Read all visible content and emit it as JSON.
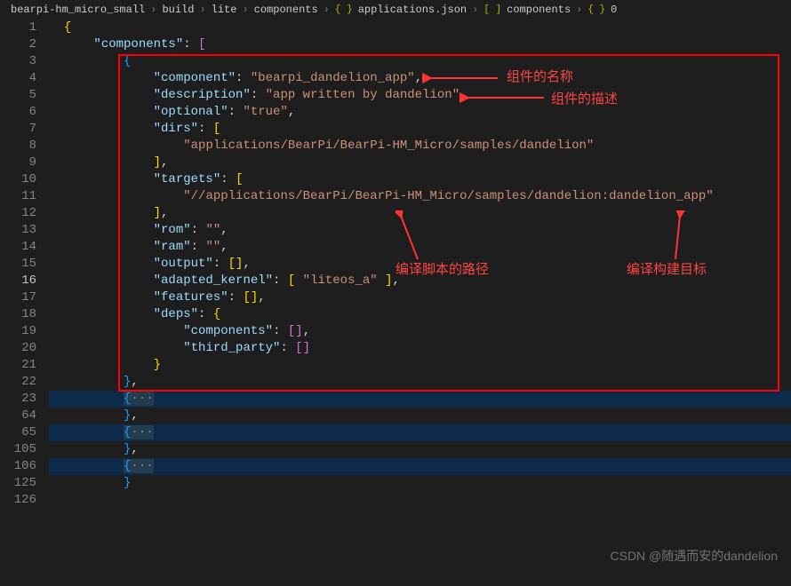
{
  "breadcrumb": {
    "items": [
      {
        "label": "bearpi-hm_micro_small",
        "icon": ""
      },
      {
        "label": "build",
        "icon": ""
      },
      {
        "label": "lite",
        "icon": ""
      },
      {
        "label": "components",
        "icon": ""
      },
      {
        "label": "applications.json",
        "icon": "{ }",
        "iconColor": "#b8b800"
      },
      {
        "label": "components",
        "icon": "[ ]",
        "iconColor": "#b8b800"
      },
      {
        "label": "0",
        "icon": "{ }",
        "iconColor": "#b8b800"
      }
    ]
  },
  "lines": {
    "l1": "1",
    "l2": "2",
    "l3": "3",
    "l4": "4",
    "l5": "5",
    "l6": "6",
    "l7": "7",
    "l8": "8",
    "l9": "9",
    "l10": "10",
    "l11": "11",
    "l12": "12",
    "l13": "13",
    "l14": "14",
    "l15": "15",
    "l16": "16",
    "l17": "17",
    "l18": "18",
    "l19": "19",
    "l20": "20",
    "l21": "21",
    "l22": "22",
    "l23": "23",
    "l64": "64",
    "l65": "65",
    "l105": "105",
    "l106": "106",
    "l125": "125",
    "l126": "126"
  },
  "code": {
    "components_key": "\"components\"",
    "component_key": "\"component\"",
    "component_val": "\"bearpi_dandelion_app\"",
    "description_key": "\"description\"",
    "description_val": "\"app written by dandelion\"",
    "optional_key": "\"optional\"",
    "optional_val": "\"true\"",
    "dirs_key": "\"dirs\"",
    "dirs_val": "\"applications/BearPi/BearPi-HM_Micro/samples/dandelion\"",
    "targets_key": "\"targets\"",
    "targets_val": "\"//applications/BearPi/BearPi-HM_Micro/samples/dandelion:dandelion_app\"",
    "rom_key": "\"rom\"",
    "rom_val": "\"\"",
    "ram_key": "\"ram\"",
    "ram_val": "\"\"",
    "output_key": "\"output\"",
    "adapted_kernel_key": "\"adapted_kernel\"",
    "adapted_kernel_val": "\"liteos_a\"",
    "features_key": "\"features\"",
    "deps_key": "\"deps\"",
    "deps_components_key": "\"components\"",
    "deps_third_party_key": "\"third_party\"",
    "ellipsis": "···"
  },
  "annotations": {
    "name": "组件的名称",
    "desc": "组件的描述",
    "path": "编译脚本的路径",
    "target": "编译构建目标"
  },
  "watermark": "CSDN @随遇而安的dandelion"
}
